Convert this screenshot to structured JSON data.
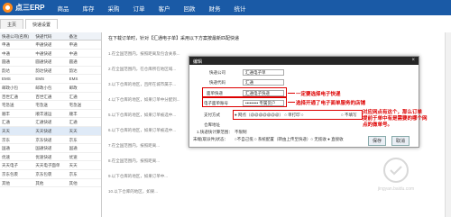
{
  "app": {
    "name": "点三ERP"
  },
  "nav": [
    "商品",
    "库存",
    "采购",
    "订单",
    "客户",
    "回款",
    "财务",
    "统计"
  ],
  "tabs": [
    "主页",
    "快递设置"
  ],
  "left_table": {
    "headers": [
      "快递公司(名称)",
      "快递代码",
      "备注"
    ],
    "rows": [
      [
        "申通",
        "申通快递",
        "申通"
      ],
      [
        "中通",
        "中通快递",
        "中通"
      ],
      [
        "圆通",
        "圆通快递",
        "圆通"
      ],
      [
        "韵达",
        "韵达快递",
        "韵达"
      ],
      [
        "EMS",
        "EMS",
        "EMS"
      ],
      [
        "邮政小包",
        "邮政小包",
        "邮政"
      ],
      [
        "百世汇通",
        "百世汇通",
        "汇通"
      ],
      [
        "宅急送",
        "宅急送",
        "宅急送"
      ],
      [
        "顺丰",
        "顺丰速运",
        "顺丰"
      ],
      [
        "汇通",
        "汇通快递",
        "汇通"
      ],
      [
        "天天",
        "天天快递",
        "天天"
      ],
      [
        "京东",
        "京东快递",
        "京东"
      ],
      [
        "国通",
        "国通快递",
        "国通"
      ],
      [
        "优速",
        "优速快递",
        "优速"
      ],
      [
        "天天电子",
        "天天电子面单",
        "天天"
      ],
      [
        "京东包裹",
        "京东包裹",
        "京东"
      ],
      [
        "其他",
        "其他",
        "其他"
      ]
    ],
    "selected_index": 10
  },
  "right": {
    "hint": "在下载订单时，针对【汇通电子单】采用以下方案按最新匹配快递",
    "items": [
      "1.在全国范围内，按照距离及包含关系...",
      "2.在全国范围内，在仓库所在地区域...",
      "3.以下仓库的地区，且所在城市属于...",
      "4.以下仓库的地区，如果订单中分配到...",
      "5.以下仓库的地区，如果订单被选中...",
      "6.以下仓库的地区，如果订单被选中...",
      "7.在全国范围内，按照距离...",
      "8.在全国范围内，按照距离...",
      "9.以下仓库的地区，如果订单中...",
      "10.以下仓库的地区，如果..."
    ]
  },
  "dialog": {
    "title": "编辑",
    "close": "×",
    "company_label": "快递公司",
    "company_value": "汇通电子单",
    "code_label": "快递代码",
    "code_value": "汇通",
    "face_label": "面单快递",
    "face_value": "汇通电子快递",
    "account_label": "电子面单账号",
    "account_value": "••••••••• 专属货户",
    "method_label": "支付方式",
    "method_options": "● 网点（@@@@@@@） ○ 单打印 ○",
    "method_tail": "○ 不填写",
    "check_label": "仓库地址",
    "range_label": "1.快递快计算范围：",
    "range_value": "不限制",
    "tail_label": "末端(取派件)状态：",
    "tail_options": "○不自己揽 ○ 系统配置（转由上传至快递）○ 无揽收 ● 直接收",
    "save": "保存",
    "cancel": "取消"
  },
  "annotations": {
    "a1": "一定要选择电子快递",
    "a2": "选择开通了电子面单服务的店铺",
    "a3": "对应网点有这个，那么订单\n提前于单中有是需要的哪个网\n点的做单号。"
  },
  "watermark": "jingyan.baidu.com"
}
